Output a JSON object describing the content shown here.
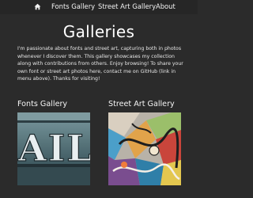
{
  "nav": {
    "home_icon": "home-icon",
    "items": [
      {
        "label": "Fonts Gallery"
      },
      {
        "label": "Street Art Gallery"
      },
      {
        "label": "About"
      }
    ]
  },
  "main": {
    "title": "Galleries",
    "intro": "I'm passionate about fonts and street art, capturing both in photos whenever I discover them. This gallery showcases my collection along with contributions from others. Enjoy browsing! To share your own font or street art photos here, contact me on GitHub (link in menu above). Thanks for visiting!",
    "galleries": [
      {
        "title": "Fonts Gallery",
        "thumbnail_text": "AIL"
      },
      {
        "title": "Street Art Gallery"
      }
    ]
  },
  "colors": {
    "background": "#2b2b2b",
    "nav_background": "#262626",
    "text": "#f2f2f2"
  }
}
